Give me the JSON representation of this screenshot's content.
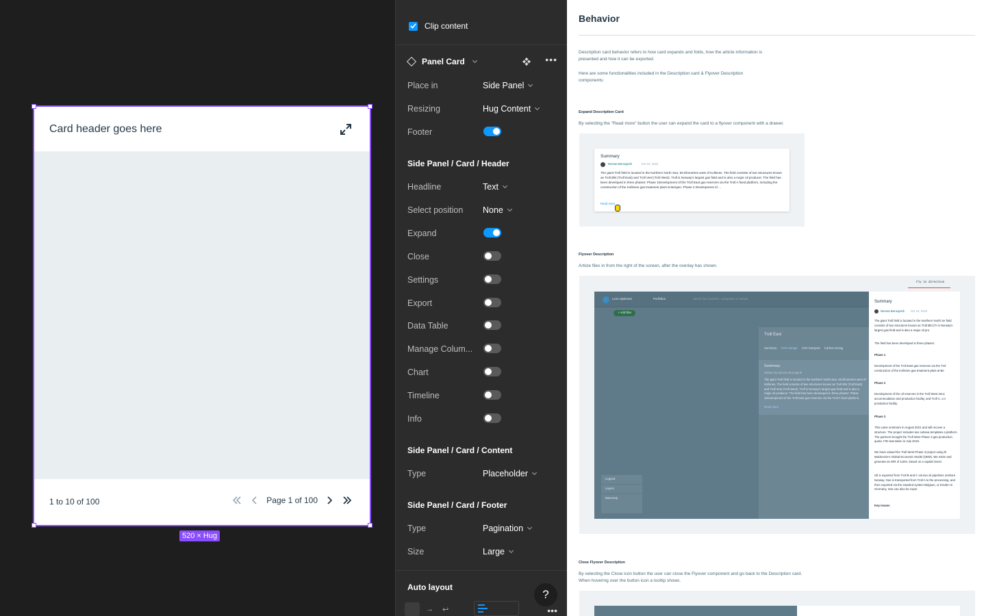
{
  "canvas": {
    "card_title": "Card header goes here",
    "footer_range": "1 to 10 of 100",
    "page_label": "Page 1 of 100",
    "size_badge": "520 × Hug",
    "selection_color": "#8a4dff"
  },
  "panel": {
    "clip_content": "Clip content",
    "component_name": "Panel Card",
    "props_top": [
      {
        "label": "Place in",
        "value": "Side Panel"
      },
      {
        "label": "Resizing",
        "value": "Hug Content"
      },
      {
        "label": "Footer",
        "toggle": true
      }
    ],
    "header_section": "Side Panel / Card / Header",
    "headline": {
      "label": "Headline",
      "value": "Text"
    },
    "select_position": {
      "label": "Select position",
      "value": "None"
    },
    "header_toggles": [
      {
        "label": "Expand",
        "on": true
      },
      {
        "label": "Close",
        "on": false
      },
      {
        "label": "Settings",
        "on": false
      },
      {
        "label": "Export",
        "on": false
      },
      {
        "label": "Data Table",
        "on": false
      },
      {
        "label": "Manage Colum...",
        "on": false
      },
      {
        "label": "Chart",
        "on": false
      },
      {
        "label": "Timeline",
        "on": false
      },
      {
        "label": "Info",
        "on": false
      }
    ],
    "content_section": "Side Panel / Card / Content",
    "content_type": {
      "label": "Type",
      "value": "Placeholder"
    },
    "footer_section": "Side Panel / Card / Footer",
    "footer_type": {
      "label": "Type",
      "value": "Pagination"
    },
    "footer_size": {
      "label": "Size",
      "value": "Large"
    },
    "auto_layout": "Auto layout",
    "help": "?",
    "accent": "#0d99ff"
  },
  "doc": {
    "title": "Behavior",
    "intro1": "Description card behavior refers to how card expands and folds, how the article information is presented and how it can be exported.",
    "intro2": "Here are some functionalities included in the Description card & Flyover Description components:",
    "expand_heading": "Expand Description Card",
    "expand_text": "By selecting the \"Read more\" button the user can expand the card to a flyover component with a drawer.",
    "summary_title": "Summary",
    "author": "Nervan Boroujerdi",
    "date": "Oct 19, 2023",
    "summary_body": "The giant Troll field is located in the Northern North Sea, 65 kilometres west of Kollsnes. The field consists of two structures known as Troll Øst (Troll East) and Troll Vest (Troll West). Troll is Norway's largest gas field and is also a major oil producer. The field has been developed in three phases: Phase 1Development of the Troll East gas reserves via the Troll A fixed platform, including the construction of the Kollsnes gas treatment plant at Bergen. Phase 2 Development of ...",
    "read_more": "Read more",
    "flyover_heading": "Flyover Description",
    "flyover_text": "Article flies in from the right of the screen, after the overlay has shown.",
    "fly_label": "Fly in direction",
    "app_name": "Lens Upstream",
    "portfolios": "Portfolios",
    "search_placeholder": "Search for countries, companies or assets",
    "add_filter": "+ Add filter",
    "field_name": "Troll East",
    "tabs": [
      "Summary",
      "CO2 storage",
      "CO2 transport",
      "Carbon storag"
    ],
    "written_by": "Written by Nervan Boroujerdi",
    "legend_items": [
      "Legend",
      "Layers",
      "Basemap"
    ],
    "drawer_p1": "The giant Troll field is located in the Northern North Se field consists of two structures known as Troll Øst (Tr is Norway's largest gas field and is also a major oil pro",
    "drawer_p2": "The field has been developed in three phases:",
    "phase1": "Phase 1",
    "phase1_text": "Development of the Troll East gas reserves via the Trol construction of the Kollsnes gas treatment plant at Be",
    "phase2": "Phase 2",
    "phase2_text": "Development of the oil reserves in the Troll West struc accommodation and production facility, and Troll C, a v production facility.",
    "phase3": "Phase 3",
    "phase3_text": "This came onstream in August 2021 and will recover a structure. The project includes two subsea templates a platform. The partners brought the Troll West Phase 3 gas production quota. FID was taken in July 2018.",
    "drawer_p3": "We have valued the Troll West Phase 3 project using th Mackenzie's Global Economic Model (GEM). We estim and generate an IRR of 115%, based on a capital invest",
    "drawer_p4": "Oil is exported from Troll B and C via two oil pipelines onshore Norway. Gas is transported from Troll A to the processing, and then exported via the Gassled system Belgium, or Emden in Germany. Gas can also be expor",
    "key_issues": "Key issues",
    "close_heading": "Close Flyover Description",
    "close_text1": "By selecting the Close icon button the user can close the Flyover component and go back to the Description card.",
    "close_text2": "When hovering over the button icon a tooltip shows."
  }
}
